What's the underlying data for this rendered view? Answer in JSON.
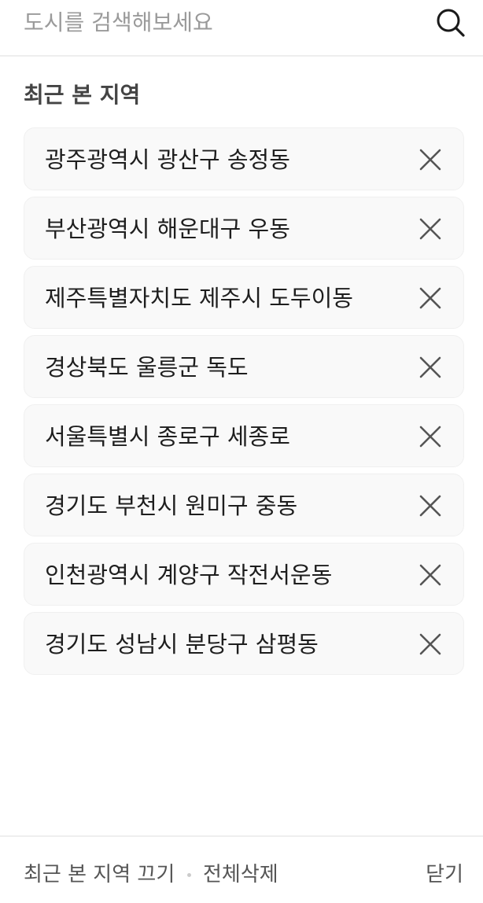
{
  "search": {
    "placeholder": "도시를 검색해보세요",
    "value": ""
  },
  "icons": {
    "search": "search-icon",
    "remove": "close-icon"
  },
  "section": {
    "title": "최근 본 지역"
  },
  "recent_locations": [
    "광주광역시 광산구 송정동",
    "부산광역시 해운대구 우동",
    "제주특별자치도 제주시 도두이동",
    "경상북도 울릉군 독도",
    "서울특별시 종로구 세종로",
    "경기도 부천시 원미구 중동",
    "인천광역시 계양구 작전서운동",
    "경기도 성남시 분당구 삼평동"
  ],
  "footer": {
    "turn_off_label": "최근 본 지역 끄기",
    "delete_all_label": "전체삭제",
    "close_label": "닫기"
  },
  "colors": {
    "background": "#ffffff",
    "item_background": "#f9f9f9",
    "placeholder": "#9a9a9a",
    "text": "#222222"
  }
}
